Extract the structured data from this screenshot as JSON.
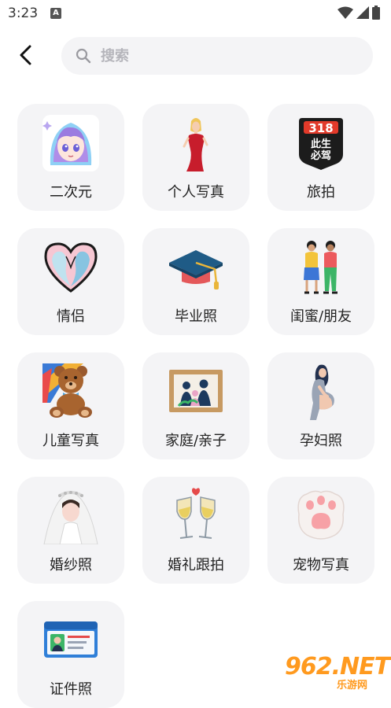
{
  "status_bar": {
    "time": "3:23",
    "notification_badge": "A"
  },
  "search": {
    "placeholder": "搜索"
  },
  "categories": [
    {
      "label": "二次元",
      "icon": "anime-girl-icon"
    },
    {
      "label": "个人写真",
      "icon": "woman-portrait-icon"
    },
    {
      "label": "旅拍",
      "icon": "route-318-sign-icon"
    },
    {
      "label": "情侣",
      "icon": "couple-heart-icon"
    },
    {
      "label": "毕业照",
      "icon": "graduation-cap-icon"
    },
    {
      "label": "闺蜜/朋友",
      "icon": "two-friends-icon"
    },
    {
      "label": "儿童写真",
      "icon": "teddy-bear-icon"
    },
    {
      "label": "家庭/亲子",
      "icon": "family-frame-icon"
    },
    {
      "label": "孕妇照",
      "icon": "pregnant-woman-icon"
    },
    {
      "label": "婚纱照",
      "icon": "wedding-veil-icon"
    },
    {
      "label": "婚礼跟拍",
      "icon": "champagne-glasses-icon"
    },
    {
      "label": "宠物写真",
      "icon": "paw-icon"
    },
    {
      "label": "证件照",
      "icon": "id-card-icon"
    }
  ],
  "route_sign": {
    "number": "318",
    "line1": "此生",
    "line2": "必驾"
  },
  "watermark": {
    "text": "962.NET",
    "sub": "乐游网"
  },
  "colors": {
    "card_bg": "#f4f4f6",
    "search_bg": "#f4f4f6",
    "accent_orange": "#ff9a1f"
  }
}
